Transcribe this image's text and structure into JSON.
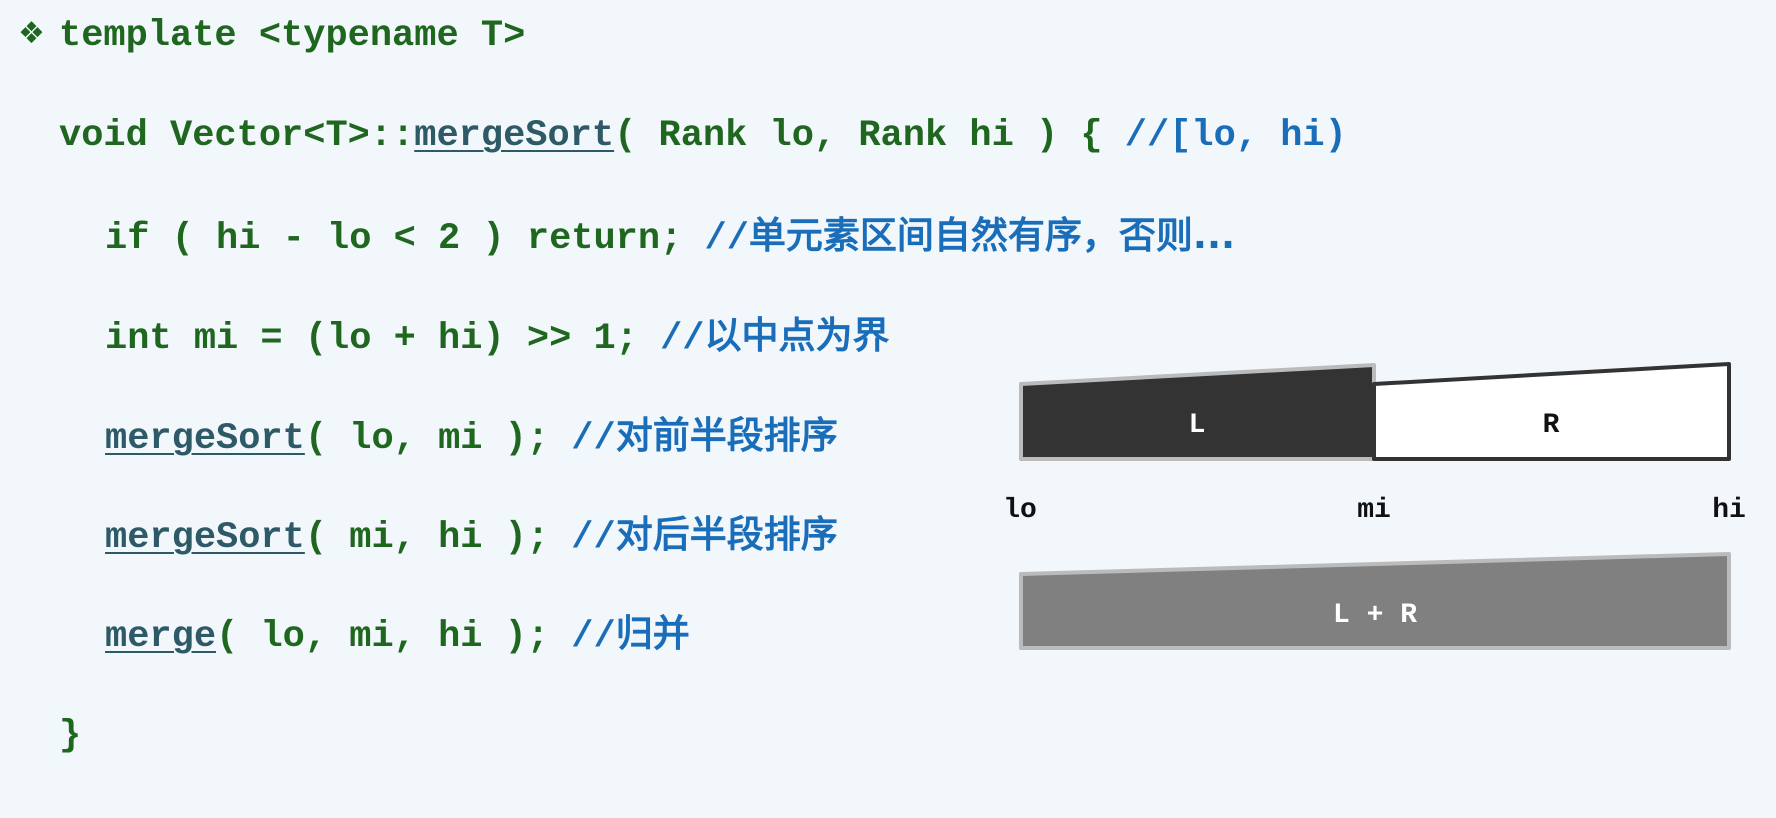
{
  "bullet_icon": "diamond-bullet-icon",
  "code": {
    "line1": "template <typename T>",
    "line2": {
      "pre": "void Vector<T>::",
      "fn": "mergeSort",
      "post": "( Rank lo, Rank hi ) { ",
      "comment": "//[lo, hi)"
    },
    "line3": {
      "code": "if ( hi - lo < 2 ) return; ",
      "comment_prefix": "//",
      "comment": "单元素区间自然有序，否则..."
    },
    "line4": {
      "code": "int mi = (lo + hi) >> 1; ",
      "comment_prefix": "//",
      "comment": "以中点为界"
    },
    "line5": {
      "fn": "mergeSort",
      "post": "( lo, mi ); ",
      "comment_prefix": "//",
      "comment": "对前半段排序"
    },
    "line6": {
      "fn": "mergeSort",
      "post": "( mi, hi ); ",
      "comment_prefix": "//",
      "comment": "对后半段排序"
    },
    "line7": {
      "fn": "merge",
      "post": "( lo, mi, hi ); ",
      "comment_prefix": "//",
      "comment": "归并"
    },
    "line8": "}"
  },
  "diagram": {
    "left_label": "L",
    "right_label": "R",
    "merged_label": "L + R",
    "lo": "lo",
    "mi": "mi",
    "hi": "hi",
    "colors": {
      "left": "#333333",
      "right": "#ffffff",
      "merged": "#808080",
      "border_light": "#bbbbbb",
      "border_dark": "#333333"
    }
  }
}
